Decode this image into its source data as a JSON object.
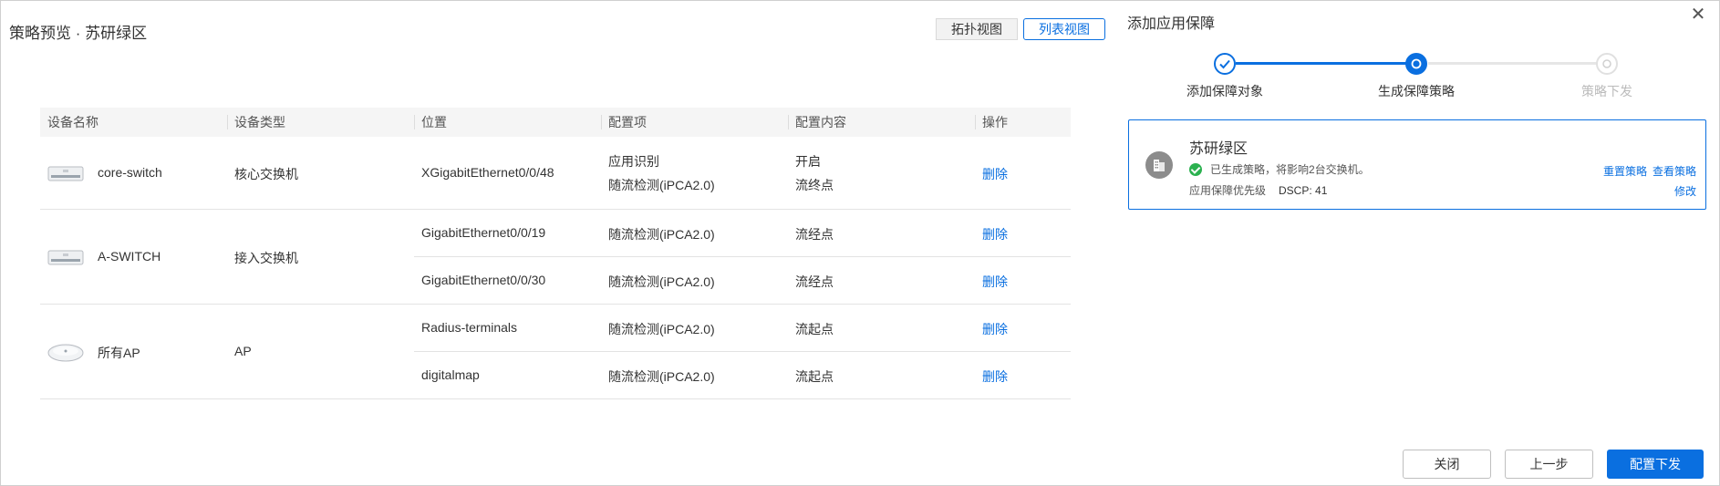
{
  "left": {
    "title": "策略预览 · 苏研绿区",
    "view_toggle": {
      "topology": "拓扑视图",
      "list": "列表视图"
    }
  },
  "table": {
    "headers": [
      "设备名称",
      "设备类型",
      "位置",
      "配置项",
      "配置内容",
      "操作"
    ],
    "devices": [
      {
        "name": "core-switch",
        "type": "核心交换机",
        "icon": "switch-icon",
        "rows": [
          {
            "location": "XGigabitEthernet0/0/48",
            "items": [
              "应用识别",
              "随流检测(iPCA2.0)"
            ],
            "contents": [
              "开启",
              "流终点"
            ],
            "action": "删除"
          }
        ]
      },
      {
        "name": "A-SWITCH",
        "type": "接入交换机",
        "icon": "switch-icon",
        "rows": [
          {
            "location": "GigabitEthernet0/0/19",
            "items": [
              "随流检测(iPCA2.0)"
            ],
            "contents": [
              "流经点"
            ],
            "action": "删除"
          },
          {
            "location": "GigabitEthernet0/0/30",
            "items": [
              "随流检测(iPCA2.0)"
            ],
            "contents": [
              "流经点"
            ],
            "action": "删除"
          }
        ]
      },
      {
        "name": "所有AP",
        "type": "AP",
        "icon": "access-point-icon",
        "rows": [
          {
            "location": "Radius-terminals",
            "items": [
              "随流检测(iPCA2.0)"
            ],
            "contents": [
              "流起点"
            ],
            "action": "删除"
          },
          {
            "location": "digitalmap",
            "items": [
              "随流检测(iPCA2.0)"
            ],
            "contents": [
              "流起点"
            ],
            "action": "删除"
          }
        ]
      }
    ]
  },
  "panel": {
    "title": "添加应用保障",
    "steps": [
      {
        "label": "添加保障对象",
        "state": "done"
      },
      {
        "label": "生成保障策略",
        "state": "active"
      },
      {
        "label": "策略下发",
        "state": "pending"
      }
    ],
    "card": {
      "name": "苏研绿区",
      "status": "已生成策略，将影响2台交换机。",
      "priority_label": "应用保障优先级",
      "priority_value": "DSCP: 41",
      "actions": {
        "reset": "重置策略",
        "view": "查看策略",
        "modify": "修改"
      }
    },
    "buttons": {
      "close": "关闭",
      "prev": "上一步",
      "deploy": "配置下发"
    }
  },
  "colors": {
    "accent": "#0a6fe0",
    "success": "#2bb14f",
    "pending": "#d9d9d9"
  }
}
